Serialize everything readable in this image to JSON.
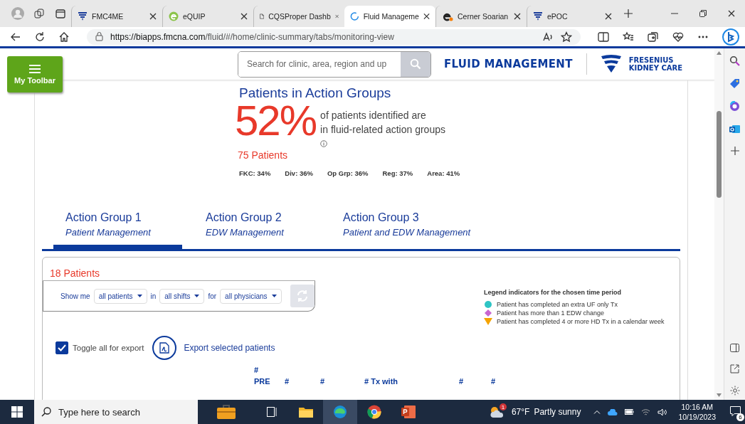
{
  "browser": {
    "tabs": [
      {
        "title": "FMC4ME",
        "kind": "fmc",
        "selected": false
      },
      {
        "title": "eQUIP",
        "kind": "equip",
        "selected": false
      },
      {
        "title": "CQSProper Dashb",
        "kind": "document",
        "selected": false
      },
      {
        "title": "Fluid Manageme",
        "kind": "loading",
        "selected": true
      },
      {
        "title": "Cerner Soarian",
        "kind": "cerner",
        "selected": false
      },
      {
        "title": "ePOC",
        "kind": "fmc",
        "selected": false
      }
    ],
    "url_host": "https://biapps.fmcna.com",
    "url_path": "/fluid/#/home/clinic-summary/tabs/monitoring-view"
  },
  "header": {
    "toolbar_button": "My Toolbar",
    "search": {
      "placeholder": "Search for clinic, area, region and up"
    },
    "app_title": "FLUID MANAGEMENT",
    "brand": [
      "FRESENIUS",
      "KIDNEY CARE"
    ]
  },
  "summary": {
    "title": "Patients in Action Groups",
    "percent": "52%",
    "description": [
      "of patients identified are",
      "in fluid-related action groups"
    ],
    "patients": "75 Patients",
    "stats": [
      "FKC: 34%",
      "Div: 36%",
      "Op Grp: 36%",
      "Reg: 37%",
      "Area: 41%"
    ]
  },
  "tabs": [
    {
      "label": "Action Group 1",
      "sublabel": "Patient Management",
      "selected": true
    },
    {
      "label": "Action Group 2",
      "sublabel": "EDW Management",
      "selected": false
    },
    {
      "label": "Action Group 3",
      "sublabel": "Patient and EDW Management",
      "selected": false
    }
  ],
  "panel": {
    "count": "18 Patients",
    "filters": [
      {
        "kind": "text",
        "text": "Show me"
      },
      {
        "kind": "dropdown",
        "text": "all patients"
      },
      {
        "kind": "text",
        "text": "in"
      },
      {
        "kind": "dropdown",
        "text": "all shifts"
      },
      {
        "kind": "text",
        "text": "for"
      },
      {
        "kind": "dropdown",
        "text": "all physicians"
      }
    ],
    "legend": {
      "title": "Legend indicators for the chosen time period",
      "items": [
        {
          "kind": "circle",
          "color": "#2ec4c4",
          "text": "Patient has completed an extra UF only Tx"
        },
        {
          "kind": "diamond",
          "color": "#c865d0",
          "text": "Patient has more than 1 EDW change"
        },
        {
          "kind": "triangle",
          "color": "#f5a300",
          "text": "Patient has completed 4 or more HD Tx in a calendar week"
        }
      ]
    },
    "toggle": {
      "label": "Toggle all for export",
      "checked": true
    },
    "export": "Export selected patients",
    "columns": [
      [
        "#",
        "PRE"
      ],
      [
        "#"
      ],
      [
        "#"
      ],
      [
        "# Tx with"
      ],
      [
        "#"
      ],
      [
        "#"
      ]
    ]
  },
  "taskbar": {
    "search": {
      "placeholder": "Type here to search"
    },
    "weather_badge": "1",
    "weather": "67°F",
    "forecast": "Partly sunny",
    "time": "10:16 AM",
    "date": "10/19/2023",
    "notifications": "6"
  }
}
